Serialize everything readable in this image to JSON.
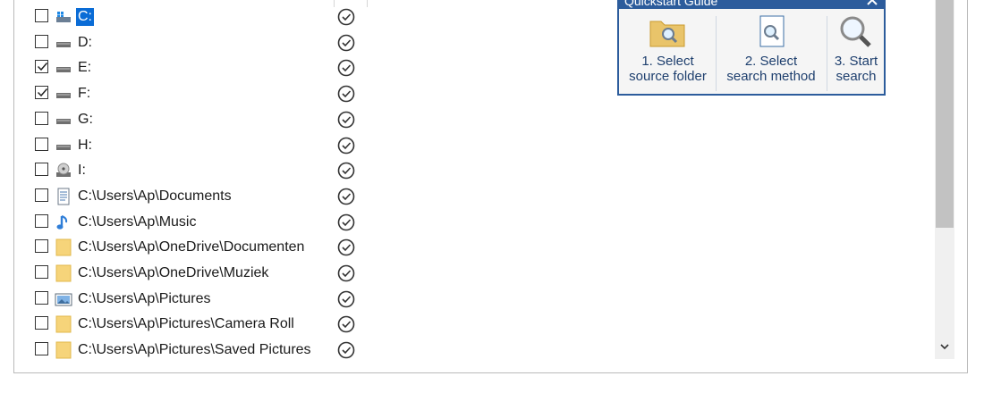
{
  "drives": [
    {
      "label": "C:",
      "checked": false,
      "icon": "windows-drive-icon",
      "selected": true
    },
    {
      "label": "D:",
      "checked": false,
      "icon": "hard-drive-icon"
    },
    {
      "label": "E:",
      "checked": true,
      "icon": "hard-drive-icon"
    },
    {
      "label": "F:",
      "checked": true,
      "icon": "hard-drive-icon"
    },
    {
      "label": "G:",
      "checked": false,
      "icon": "hard-drive-icon"
    },
    {
      "label": "H:",
      "checked": false,
      "icon": "hard-drive-icon"
    },
    {
      "label": "I:",
      "checked": false,
      "icon": "optical-drive-icon"
    },
    {
      "label": "C:\\Users\\Ap\\Documents",
      "checked": false,
      "icon": "documents-icon"
    },
    {
      "label": "C:\\Users\\Ap\\Music",
      "checked": false,
      "icon": "music-note-icon"
    },
    {
      "label": "C:\\Users\\Ap\\OneDrive\\Documenten",
      "checked": false,
      "icon": "folder-icon"
    },
    {
      "label": "C:\\Users\\Ap\\OneDrive\\Muziek",
      "checked": false,
      "icon": "folder-icon"
    },
    {
      "label": "C:\\Users\\Ap\\Pictures",
      "checked": false,
      "icon": "pictures-icon"
    },
    {
      "label": "C:\\Users\\Ap\\Pictures\\Camera Roll",
      "checked": false,
      "icon": "folder-icon"
    },
    {
      "label": "C:\\Users\\Ap\\Pictures\\Saved Pictures",
      "checked": false,
      "icon": "folder-icon"
    }
  ],
  "quickstart": {
    "title": "Quickstart Guide",
    "step1_line1": "1. Select",
    "step1_line2": "source folder",
    "step2_line1": "2. Select",
    "step2_line2": "search method",
    "step3_line1": "3. Start",
    "step3_line2": "search"
  },
  "colors": {
    "accent": "#2c5c9c",
    "selection": "#0a6cd6"
  }
}
